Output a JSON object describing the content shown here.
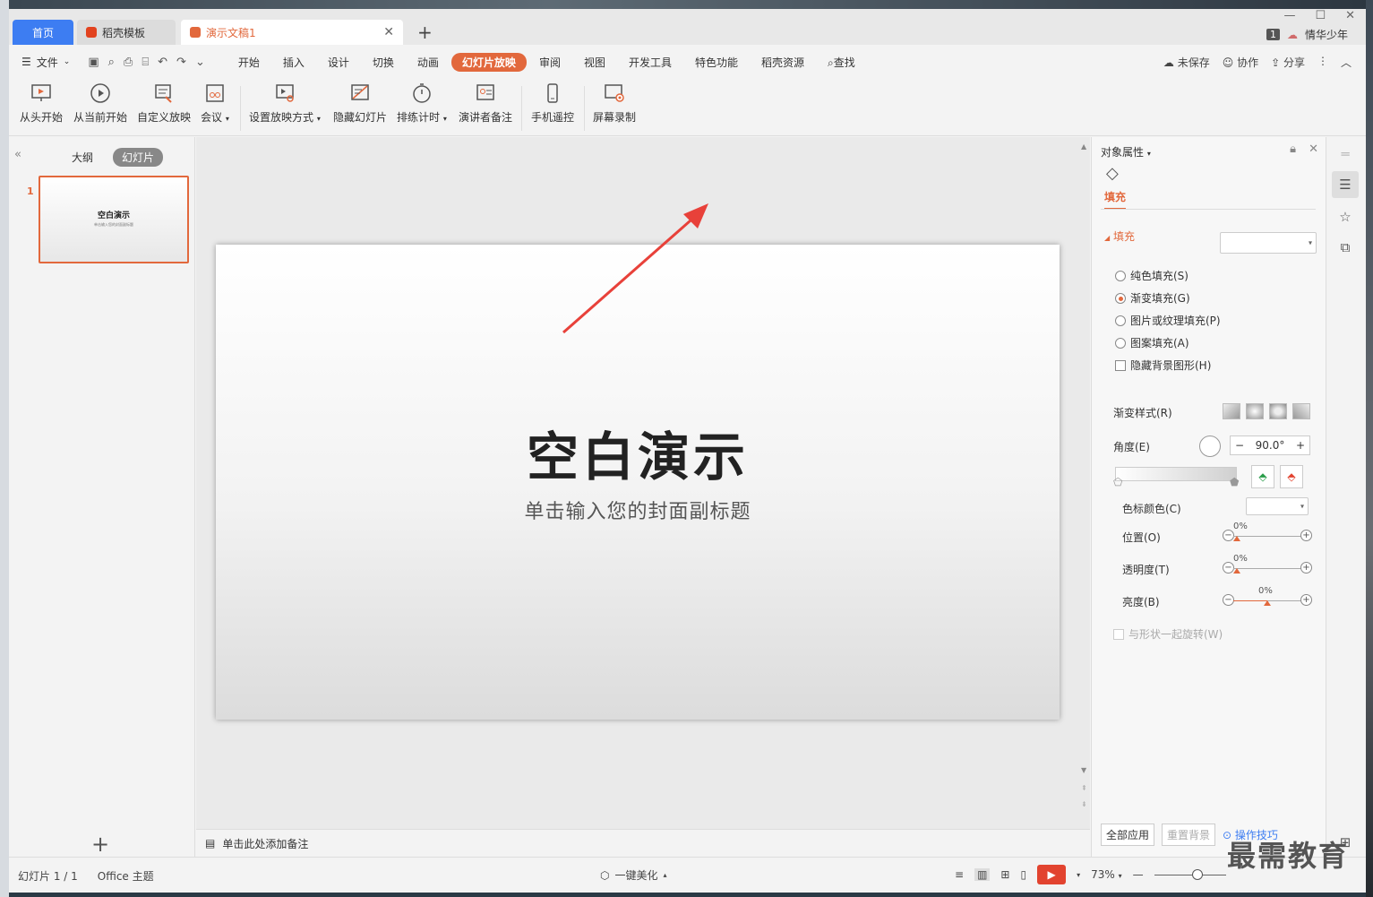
{
  "tabs": {
    "home": "首页",
    "template": "稻壳模板",
    "doc": "演示文稿1"
  },
  "user": {
    "badge": "1",
    "name": "情华少年"
  },
  "menu": {
    "file": "文件",
    "tabs": [
      "开始",
      "插入",
      "设计",
      "切换",
      "动画",
      "幻灯片放映",
      "审阅",
      "视图",
      "开发工具",
      "特色功能",
      "稻壳资源"
    ],
    "active_tab": "幻灯片放映",
    "search": "查找",
    "unsaved": "未保存",
    "collab": "协作",
    "share": "分享"
  },
  "ribbon": {
    "from_start": "从头开始",
    "from_current": "从当前开始",
    "custom_show": "自定义放映",
    "meeting": "会议",
    "setup_show": "设置放映方式",
    "hide_slide": "隐藏幻灯片",
    "rehearse": "排练计时",
    "presenter_notes": "演讲者备注",
    "phone_remote": "手机遥控",
    "screen_record": "屏幕录制"
  },
  "left_panel": {
    "outline_tab": "大纲",
    "slides_tab": "幻灯片",
    "thumb_number": "1",
    "thumb_title": "空白演示",
    "thumb_sub": "单击输入您的封面副标题"
  },
  "slide": {
    "title": "空白演示",
    "subtitle": "单击输入您的封面副标题"
  },
  "notes": {
    "placeholder": "单击此处添加备注"
  },
  "props": {
    "panel_title": "对象属性",
    "fill_tab": "填充",
    "fill_section": "填充",
    "opt_solid": "纯色填充(S)",
    "opt_gradient": "渐变填充(G)",
    "opt_picture": "图片或纹理填充(P)",
    "opt_pattern": "图案填充(A)",
    "opt_hide_bg": "隐藏背景图形(H)",
    "gradient_style": "渐变样式(R)",
    "angle_label": "角度(E)",
    "angle_value": "90.0°",
    "stop_color": "色标颜色(C)",
    "position": "位置(O)",
    "position_value": "0%",
    "transparency": "透明度(T)",
    "transparency_value": "0%",
    "brightness": "亮度(B)",
    "brightness_value": "0%",
    "rotate_with_shape": "与形状一起旋转(W)",
    "apply_all": "全部应用",
    "reset_bg": "重置背景",
    "tips": "操作技巧"
  },
  "status": {
    "slide_count": "幻灯片 1 / 1",
    "theme": "Office 主题",
    "beautify": "一键美化",
    "zoom": "73%"
  },
  "watermark": "最需教育",
  "colors": {
    "accent": "#e2683c",
    "home_tab": "#3d7df2",
    "play": "#e2432f",
    "arrow": "#e8413a"
  }
}
